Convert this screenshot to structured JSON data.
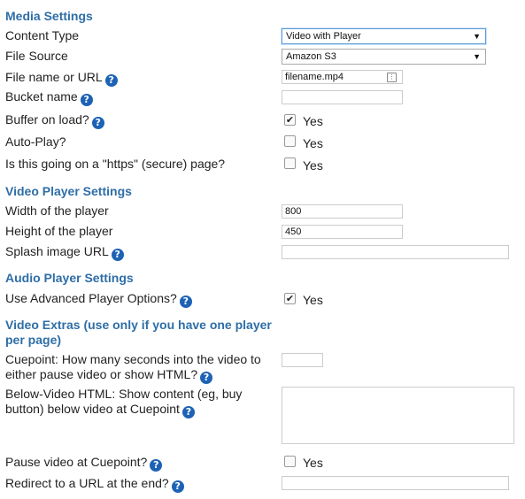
{
  "media": {
    "section_title": "Media Settings",
    "content_type": {
      "label": "Content Type",
      "value": "Video with Player"
    },
    "file_source": {
      "label": "File Source",
      "value": "Amazon S3"
    },
    "file_name": {
      "label": "File name or URL",
      "value": "filename.mp4"
    },
    "bucket_name": {
      "label": "Bucket name",
      "value": ""
    },
    "buffer_on_load": {
      "label": "Buffer on load?",
      "checked": true,
      "option": "Yes"
    },
    "auto_play": {
      "label": "Auto-Play?",
      "checked": false,
      "option": "Yes"
    },
    "https_page": {
      "label": "Is this going on a \"https\" (secure) page?",
      "checked": false,
      "option": "Yes"
    }
  },
  "video_player": {
    "section_title": "Video Player Settings",
    "width": {
      "label": "Width of the player",
      "value": "800"
    },
    "height": {
      "label": "Height of the player",
      "value": "450"
    },
    "splash": {
      "label": "Splash image URL",
      "value": ""
    }
  },
  "audio_player": {
    "section_title": "Audio Player Settings",
    "advanced": {
      "label": "Use Advanced Player Options?",
      "checked": true,
      "option": "Yes"
    }
  },
  "video_extras": {
    "section_title": "Video Extras (use only if you have one player per page)",
    "cuepoint": {
      "label": "Cuepoint: How many seconds into the video to either pause video or show HTML?",
      "value": ""
    },
    "below_html": {
      "label": "Below-Video HTML: Show content (eg, buy button) below video at Cuepoint",
      "value": ""
    },
    "pause_at_cuepoint": {
      "label": "Pause video at Cuepoint?",
      "checked": false,
      "option": "Yes"
    },
    "redirect": {
      "label": "Redirect to a URL at the end?",
      "value": ""
    }
  },
  "icons": {
    "help": "?",
    "check": "✔",
    "dropdown": "▼",
    "field_key": "key-icon"
  },
  "colors": {
    "section_heading": "#2e6ea7",
    "help_icon": "#1d62b5",
    "text": "#222222",
    "focus_border": "#5b9dd9"
  }
}
